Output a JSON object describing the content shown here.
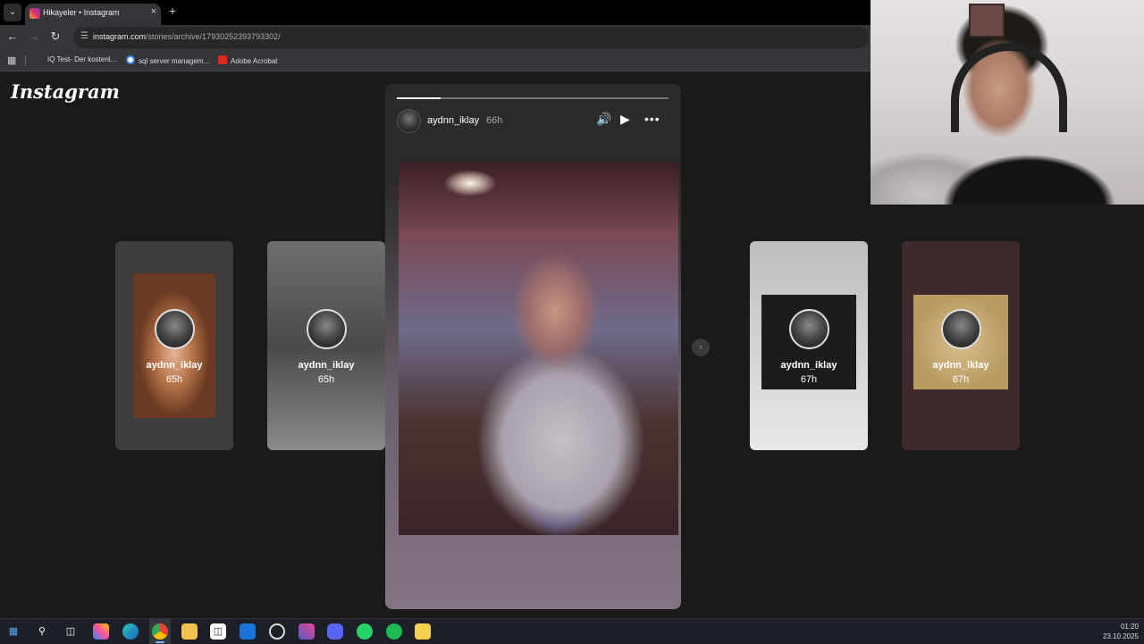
{
  "browser": {
    "tab_title": "Hikayeler • Instagram",
    "tab_close": "×",
    "new_tab": "+",
    "url_host": "instagram.com",
    "url_path": "/stories/archive/17930252393793302/",
    "bookmarks": [
      {
        "label": "IQ Test- Der kostenl...",
        "icon_color": "#e8e8e8"
      },
      {
        "label": "sql server managem...",
        "icon_color": "#4285f4"
      },
      {
        "label": "Adobe Acrobat",
        "icon_color": "#e0261e"
      }
    ]
  },
  "page": {
    "logo": "Instagram",
    "story": {
      "username": "aydnn_iklay",
      "time": "66h",
      "progress": 0.16
    },
    "previews": [
      {
        "username": "aydnn_iklay",
        "time": "65h"
      },
      {
        "username": "aydnn_iklay",
        "time": "65h"
      },
      {
        "username": "aydnn_iklay",
        "time": "67h"
      },
      {
        "username": "aydnn_iklay",
        "time": "67h"
      }
    ]
  },
  "taskbar": {
    "time": "01:20",
    "date": "23.10.2025"
  },
  "icons": [
    "tab-list-icon",
    "back-icon",
    "forward-icon",
    "reload-icon",
    "site-info-icon",
    "apps-grid-icon",
    "mute-icon",
    "play-icon",
    "more-icon",
    "next-arrow-icon",
    "windows-start-icon",
    "search-icon",
    "task-view-icon",
    "copilot-icon",
    "edge-icon",
    "chrome-icon",
    "file-explorer-icon",
    "store-icon",
    "outlook-icon",
    "clock-app-icon",
    "teams-icon",
    "discord-icon",
    "whatsapp-icon",
    "spotify-icon",
    "sticky-notes-icon"
  ]
}
